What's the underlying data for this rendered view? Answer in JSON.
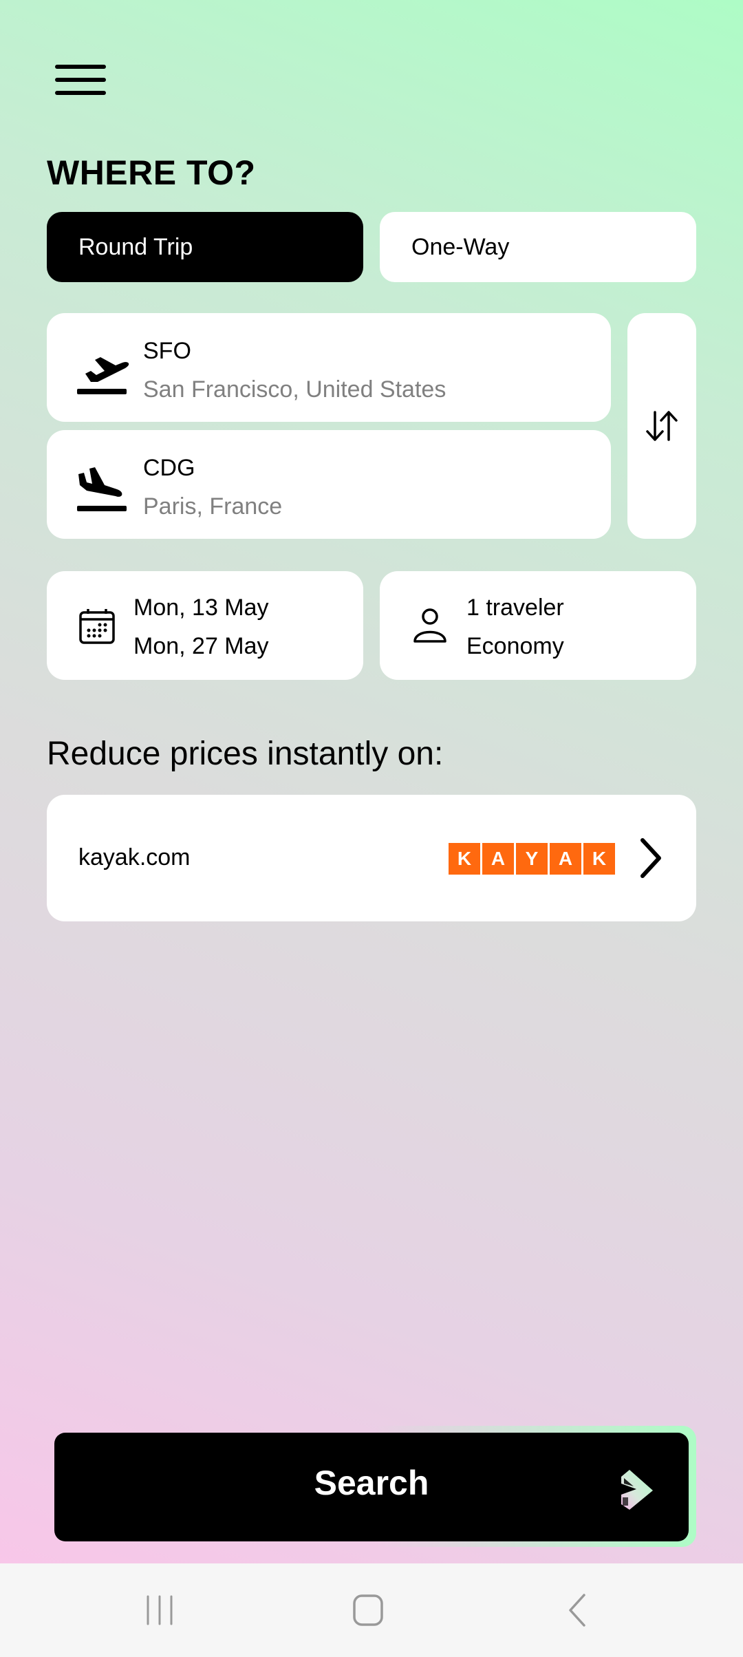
{
  "header": {
    "menu_icon": "hamburger-menu-icon",
    "title": "WHERE TO?"
  },
  "trip_type": {
    "options": [
      {
        "label": "Round Trip",
        "selected": true
      },
      {
        "label": "One-Way",
        "selected": false
      }
    ]
  },
  "route": {
    "from": {
      "code": "SFO",
      "city": "San Francisco, United States",
      "icon": "plane-takeoff-icon"
    },
    "to": {
      "code": "CDG",
      "city": "Paris, France",
      "icon": "plane-landing-icon"
    },
    "swap_icon": "swap-vertical-arrows-icon"
  },
  "dates": {
    "icon": "calendar-icon",
    "depart": "Mon, 13 May",
    "return": "Mon, 27 May"
  },
  "travelers": {
    "icon": "person-icon",
    "count": "1 traveler",
    "cabin": "Economy"
  },
  "partners": {
    "title": "Reduce prices instantly on:",
    "items": [
      {
        "name": "kayak.com",
        "logo_letters": [
          "K",
          "A",
          "Y",
          "A",
          "K"
        ],
        "logo_color": "#ff690f",
        "chevron_icon": "chevron-right-icon"
      }
    ]
  },
  "search": {
    "label": "Search",
    "logo_icon": "app-logo-chevron-icon"
  },
  "system_nav": {
    "recents_icon": "recents-icon",
    "home_icon": "home-icon",
    "back_icon": "back-icon"
  },
  "colors": {
    "bg_green": "#aefcc6",
    "bg_gray": "#dcdcdc",
    "bg_pink": "#fcc4ea",
    "secondary_text": "#808080",
    "kayak_orange": "#ff690f"
  }
}
